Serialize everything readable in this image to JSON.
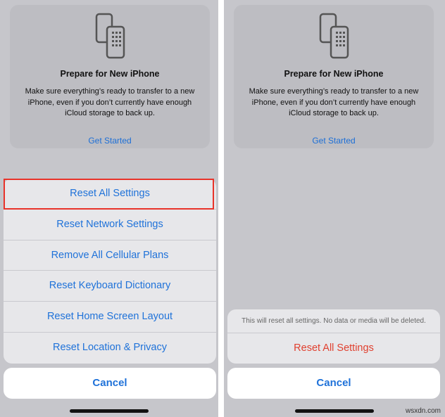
{
  "left": {
    "card": {
      "icon": "two-phones-icon",
      "title": "Prepare for New iPhone",
      "description_lines": [
        "Make sure everything’s ready to transfer to a new",
        "iPhone, even if you don’t currently have enough",
        "iCloud storage to back up."
      ],
      "link": "Get Started"
    },
    "sheet_items": [
      "Reset All Settings",
      "Reset Network Settings",
      "Remove All Cellular Plans",
      "Reset Keyboard Dictionary",
      "Reset Home Screen Layout",
      "Reset Location & Privacy"
    ],
    "cancel": "Cancel"
  },
  "right": {
    "card": {
      "icon": "two-phones-icon",
      "title": "Prepare for New iPhone",
      "description_lines": [
        "Make sure everything’s ready to transfer to a new",
        "iPhone, even if you don’t currently have enough",
        "iCloud storage to back up."
      ],
      "link": "Get Started"
    },
    "confirm_note": "This will reset all settings. No data or media will be deleted.",
    "confirm_action": "Reset All Settings",
    "cancel": "Cancel"
  },
  "watermark": "wsxdn.com",
  "colors": {
    "accent_blue": "#1f72d9",
    "destructive_red": "#e0402f",
    "highlight_red": "#e8332a"
  }
}
